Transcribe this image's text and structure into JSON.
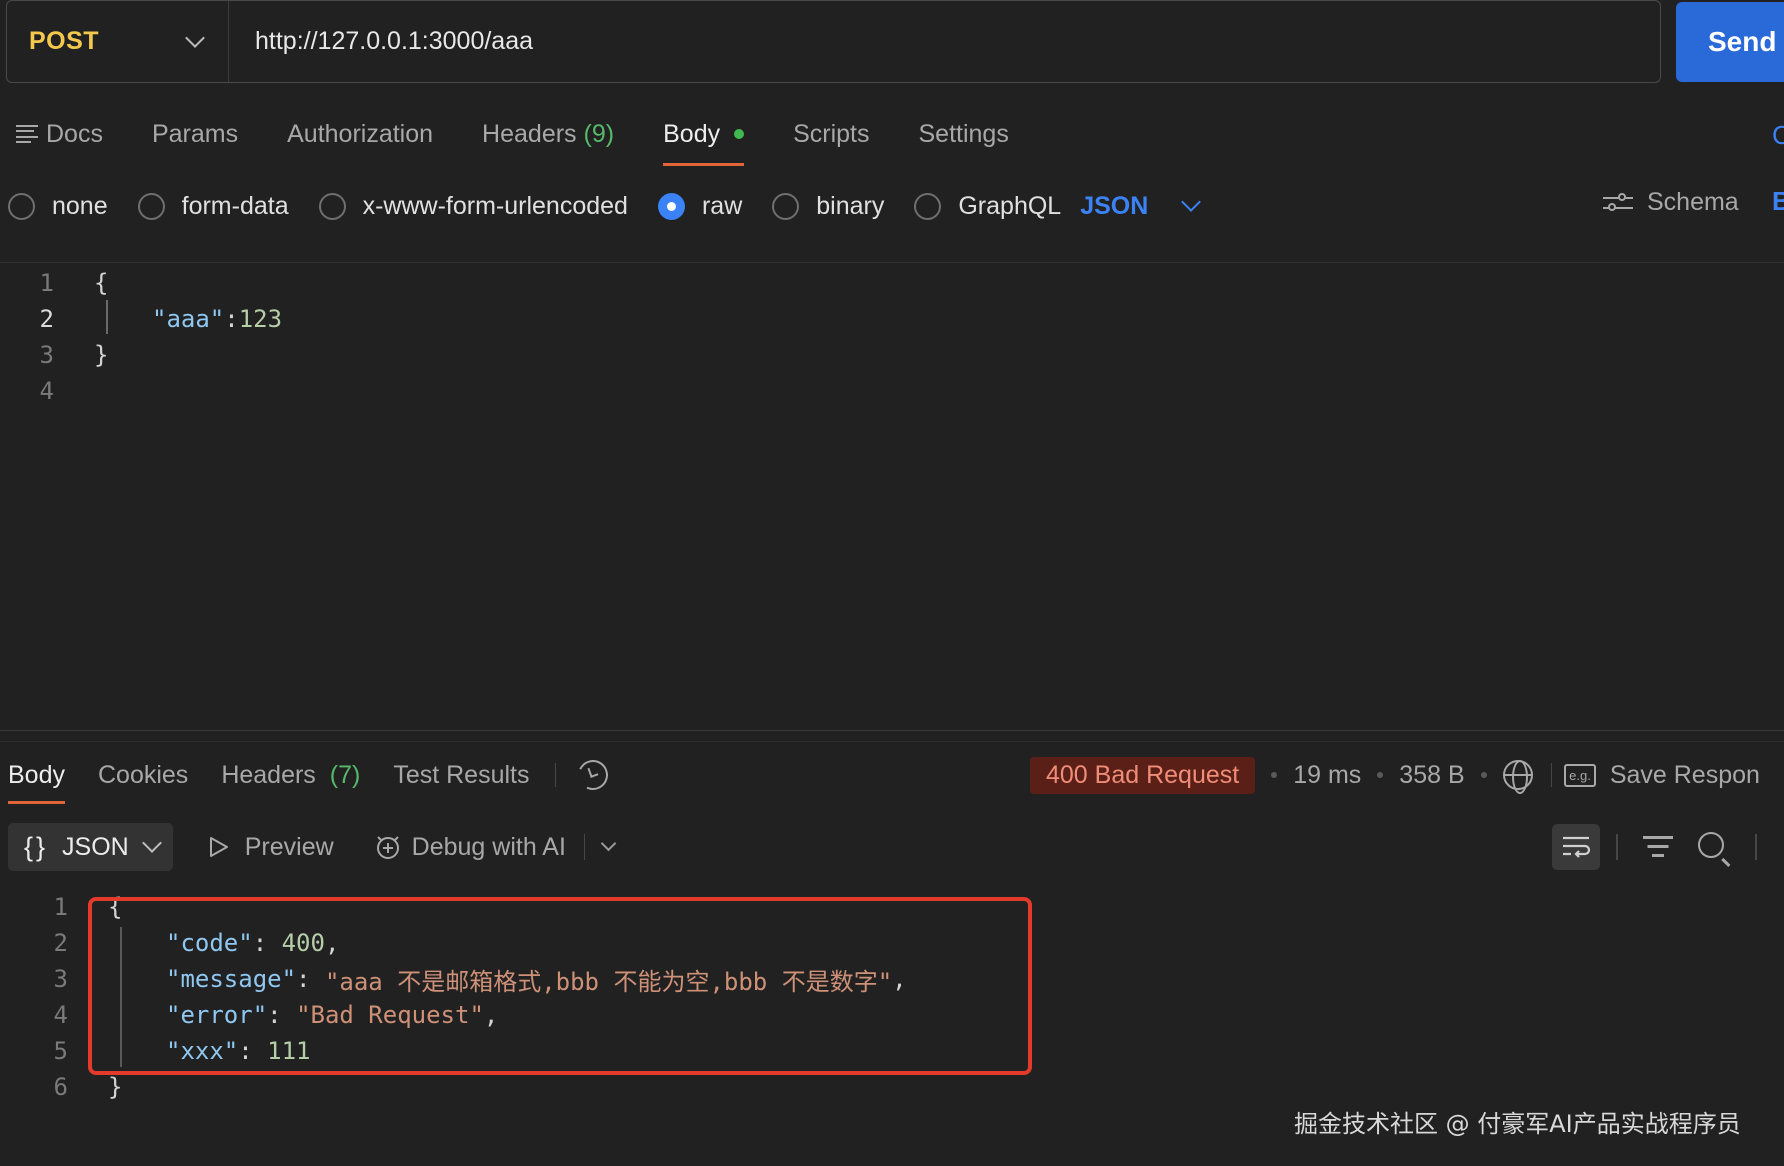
{
  "request": {
    "method": "POST",
    "url": "http://127.0.0.1:3000/aaa",
    "send_label": "Send"
  },
  "request_tabs": {
    "docs": "Docs",
    "params": "Params",
    "authorization": "Authorization",
    "headers": "Headers",
    "headers_count": "(9)",
    "body": "Body",
    "scripts": "Scripts",
    "settings": "Settings",
    "cut_right": "C"
  },
  "body_types": {
    "none": "none",
    "form_data": "form-data",
    "urlencoded": "x-www-form-urlencoded",
    "raw": "raw",
    "binary": "binary",
    "graphql": "GraphQL",
    "format": "JSON",
    "selected": "raw",
    "schema": "Schema",
    "cut_right": "B"
  },
  "request_body": {
    "line_numbers": [
      "1",
      "2",
      "3",
      "4"
    ],
    "open_brace": "{",
    "key": "\"aaa\"",
    "colon": ":",
    "value": "123",
    "close_brace": "}"
  },
  "response_tabs": {
    "body": "Body",
    "cookies": "Cookies",
    "headers": "Headers",
    "headers_count": "(7)",
    "test_results": "Test Results"
  },
  "response_meta": {
    "status": "400 Bad Request",
    "time": "19 ms",
    "size": "358 B",
    "eg": "e.g.",
    "save_response": "Save Respon"
  },
  "response_toolbar": {
    "format": "JSON",
    "preview": "Preview",
    "debug": "Debug with AI"
  },
  "response_body": {
    "line_numbers": [
      "1",
      "2",
      "3",
      "4",
      "5",
      "6"
    ],
    "open_brace": "{",
    "close_brace": "}",
    "code_key": "\"code\"",
    "code_value": "400",
    "message_key": "\"message\"",
    "message_value": "\"aaa 不是邮箱格式,bbb 不能为空,bbb 不是数字\"",
    "error_key": "\"error\"",
    "error_value": "\"Bad Request\"",
    "xxx_key": "\"xxx\"",
    "xxx_value": "111"
  },
  "colors": {
    "accent": "#e0663a",
    "send": "#2a69d8",
    "method": "#f2c94c",
    "status_bg": "#5a1f16",
    "highlight_box": "#e33a2b"
  },
  "watermark": "掘金技术社区 @ 付豪军AI产品实战程序员"
}
